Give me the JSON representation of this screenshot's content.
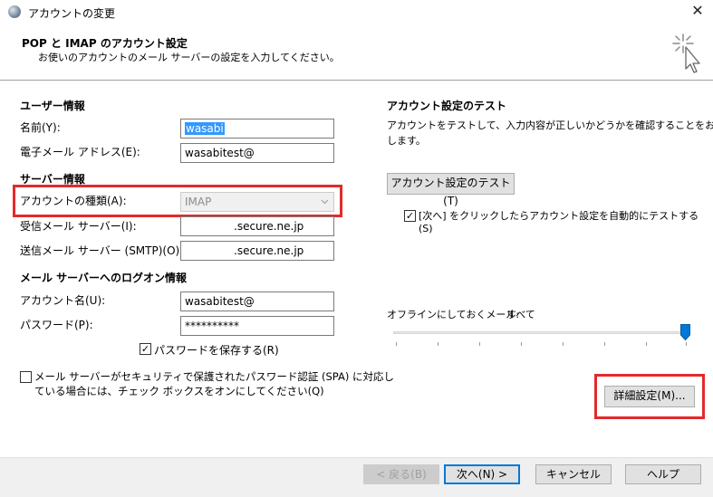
{
  "window": {
    "title": "アカウントの変更",
    "close_glyph": "✕"
  },
  "header": {
    "title": "POP と IMAP のアカウント設定",
    "subtitle": "お使いのアカウントのメール サーバーの設定を入力してください。"
  },
  "user_info": {
    "section": "ユーザー情報",
    "name_label": "名前(Y):",
    "name_value": "wasabi",
    "email_label": "電子メール アドレス(E):",
    "email_value": "wasabitest@"
  },
  "server_info": {
    "section": "サーバー情報",
    "account_type_label": "アカウントの種類(A):",
    "account_type_value": "IMAP",
    "incoming_label": "受信メール サーバー(I):",
    "incoming_value": ".secure.ne.jp",
    "outgoing_label": "送信メール サーバー (SMTP)(O):",
    "outgoing_value": ".secure.ne.jp"
  },
  "logon_info": {
    "section": "メール サーバーへのログオン情報",
    "account_name_label": "アカウント名(U):",
    "account_name_value": "wasabitest@",
    "password_label": "パスワード(P):",
    "password_value": "**********",
    "save_password_label": "パスワードを保存する(R)",
    "save_password_checked": true,
    "spa_label_line1": "メール サーバーがセキュリティで保護されたパスワード認証 (SPA) に対応し",
    "spa_label_line2": "ている場合には、チェック ボックスをオンにしてください(Q)",
    "spa_checked": false
  },
  "test": {
    "section": "アカウント設定のテスト",
    "desc_line1": "アカウントをテストして、入力内容が正しいかどうかを確認することをお勧め",
    "desc_line2": "します。",
    "test_button": "アカウント設定のテスト(T)",
    "auto_test_line1": "[次へ] をクリックしたらアカウント設定を自動的にテストする",
    "auto_test_line2": "(S)",
    "auto_test_checked": true
  },
  "offline": {
    "label": "オフラインにしておくメール:",
    "value": "すべて",
    "slider_fraction": 1.0
  },
  "buttons": {
    "more_settings": "詳細設定(M)...",
    "back": "< 戻る(B)",
    "next": "次へ(N) >",
    "cancel": "キャンセル",
    "help": "ヘルプ"
  },
  "colors": {
    "highlight_box": "#e32a2a",
    "selection": "#3399ff",
    "primary_border": "#0078d7",
    "slider_thumb": "#0078d7"
  },
  "icons": {
    "app": "outlook-globe-icon",
    "header": "magic-wand-cursor-icon"
  }
}
